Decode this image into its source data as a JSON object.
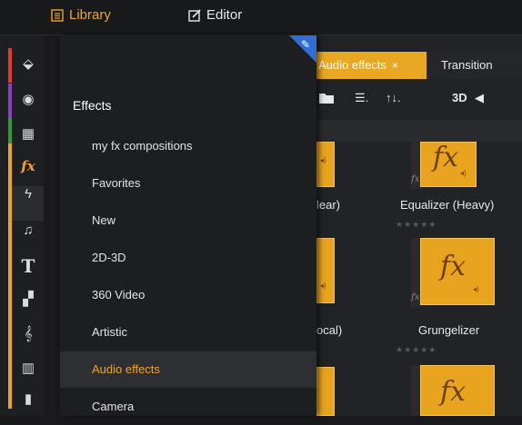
{
  "topbar": {
    "library_label": "Library",
    "editor_label": "Editor"
  },
  "categories": [
    {
      "icon": "layers-icon",
      "glyph": "⬙",
      "stripe": "#e23b32"
    },
    {
      "icon": "film-reel-icon",
      "glyph": "◉",
      "stripe": "#8b3fc9"
    },
    {
      "icon": "stack-icon",
      "glyph": "▦",
      "stripe": "#2f9a3a"
    },
    {
      "icon": "fx-icon",
      "glyph": "fx",
      "stripe": "#e9a824"
    },
    {
      "icon": "lightning-icon",
      "glyph": "ϟ",
      "stripe": "#e9a824"
    },
    {
      "icon": "music-note-icon",
      "glyph": "♫",
      "stripe": "#e9a824"
    },
    {
      "icon": "title-icon",
      "glyph": "T",
      "stripe": "#e9a824"
    },
    {
      "icon": "grid-icon",
      "glyph": "▞",
      "stripe": "#e9a824"
    },
    {
      "icon": "treble-clef-icon",
      "glyph": "𝄞",
      "stripe": "#e9a824"
    },
    {
      "icon": "keyboard-icon",
      "glyph": "▥",
      "stripe": "#e9a824"
    },
    {
      "icon": "equalizer-icon",
      "glyph": "▮",
      "stripe": "#e9a824"
    }
  ],
  "effects_panel": {
    "heading": "Effects",
    "items": [
      "my fx compositions",
      "Favorites",
      "New",
      "2D-3D",
      "360 Video",
      "Artistic",
      "Audio effects",
      "Camera"
    ],
    "selected": "Audio effects"
  },
  "tabs": {
    "audio_effects": "Audio effects",
    "audio_close": "×",
    "transitions": "Transition"
  },
  "toolbar": {
    "list_icon": "☰.",
    "sort_icon": "↑↓.",
    "mode_3d": "3D"
  },
  "thumbnails": {
    "fx_glyph": "fx",
    "stars": "★★★★★",
    "labels": {
      "row1_left": "lear)",
      "row1_right": "Equalizer (Heavy)",
      "row2_left": "ocal)",
      "row2_right": "Grungelizer"
    }
  },
  "colors": {
    "accent": "#e9a824",
    "library_orange": "#f0a32c",
    "pin_blue": "#2f6fd4"
  }
}
